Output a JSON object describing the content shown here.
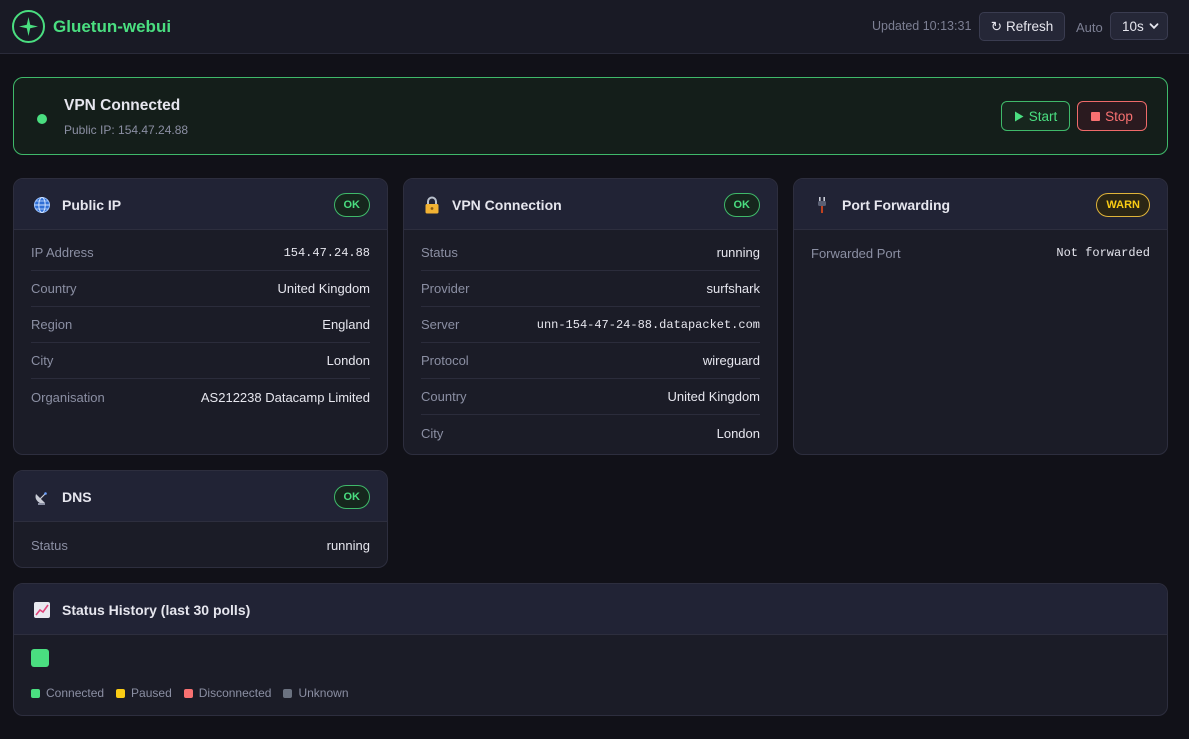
{
  "header": {
    "title": "Gluetun-webui",
    "updated": "Updated 10:13:31",
    "refresh_label": "Refresh",
    "auto_label": "Auto",
    "auto_interval": "10s"
  },
  "banner": {
    "title": "VPN Connected",
    "subtitle": "Public IP: 154.47.24.88",
    "start_label": "Start",
    "stop_label": "Stop"
  },
  "cards": {
    "public_ip": {
      "title": "Public IP",
      "badge": "OK",
      "rows": [
        {
          "k": "IP Address",
          "v": "154.47.24.88"
        },
        {
          "k": "Country",
          "v": "United Kingdom"
        },
        {
          "k": "Region",
          "v": "England"
        },
        {
          "k": "City",
          "v": "London"
        },
        {
          "k": "Organisation",
          "v": "AS212238 Datacamp Limited"
        }
      ]
    },
    "vpn": {
      "title": "VPN Connection",
      "badge": "OK",
      "rows": [
        {
          "k": "Status",
          "v": "running"
        },
        {
          "k": "Provider",
          "v": "surfshark"
        },
        {
          "k": "Server",
          "v": "unn-154-47-24-88.datapacket.com"
        },
        {
          "k": "Protocol",
          "v": "wireguard"
        },
        {
          "k": "Country",
          "v": "United Kingdom"
        },
        {
          "k": "City",
          "v": "London"
        }
      ]
    },
    "port": {
      "title": "Port Forwarding",
      "badge": "WARN",
      "rows": [
        {
          "k": "Forwarded Port",
          "v": "Not forwarded"
        }
      ]
    },
    "dns": {
      "title": "DNS",
      "badge": "OK",
      "rows": [
        {
          "k": "Status",
          "v": "running"
        }
      ]
    }
  },
  "history": {
    "title": "Status History (last 30 polls)",
    "legend": [
      "Connected",
      "Paused",
      "Disconnected",
      "Unknown"
    ]
  },
  "colors": {
    "connected": "#4ade80",
    "paused": "#facc15",
    "disconnected": "#f87171",
    "unknown": "#6b7280"
  }
}
